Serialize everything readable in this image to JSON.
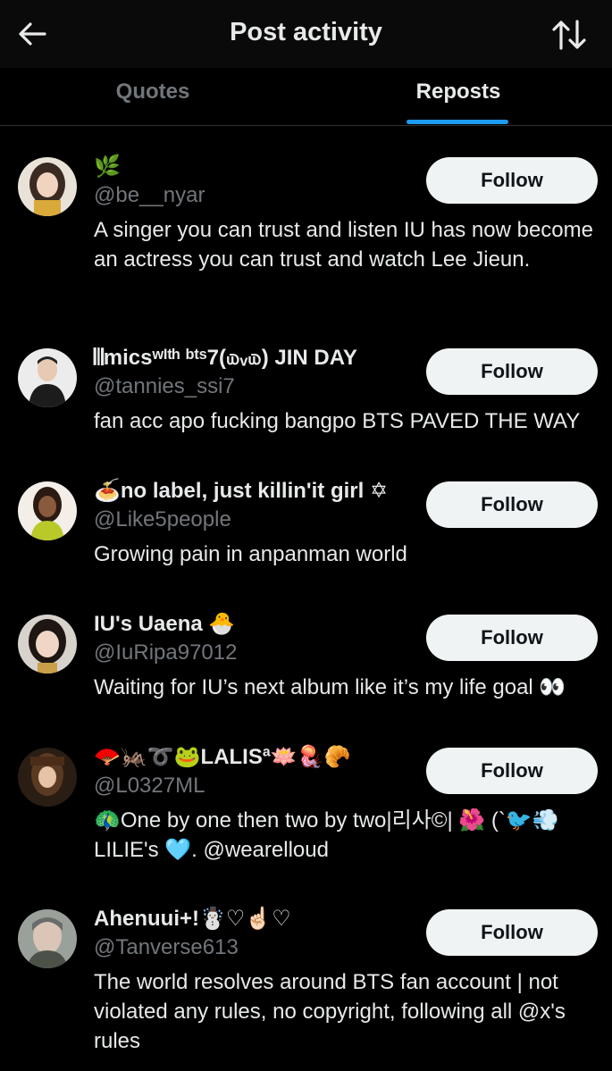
{
  "header": {
    "title": "Post activity",
    "back_icon": "arrow-left-icon",
    "sort_icon": "sort-arrows-icon"
  },
  "tabs": [
    {
      "label": "Quotes",
      "active": false
    },
    {
      "label": "Reposts",
      "active": true
    }
  ],
  "colors": {
    "background": "#000000",
    "accent": "#1d9bf0",
    "follow_button_bg": "#eff3f4",
    "text_secondary": "#71767b"
  },
  "users": [
    {
      "name": "🌿",
      "handle": "@be__nyar",
      "bio": "A singer you can trust and listen IU has now become an actress you can trust and watch Lee Jieun.",
      "follow_label": "Follow"
    },
    {
      "name": "𝄃𝄂micsʷᴵᵗʰ ᵇᵗˢ7(௰ᵥ௰) JIN DAY",
      "handle": "@tannies_ssi7",
      "bio": "fan acc apo fucking bangpo BTS PAVED THE WAY",
      "follow_label": "Follow"
    },
    {
      "name": "🍝no label, just killin'it girl ✡",
      "handle": "@Like5people",
      "bio": "Growing pain in anpanman world",
      "follow_label": "Follow"
    },
    {
      "name": "IU's Uaena 🐣",
      "handle": "@IuRipa97012",
      "bio": "Waiting for IU’s next album like it’s my life goal 👀",
      "follow_label": "Follow"
    },
    {
      "name": "🪭🦗➰🐸LALISª🪷🪼🥐",
      "handle": "@L0327ML",
      "bio": "🦚One by one then two by two|리사©| 🌺 (`🐦💨 LILIE's 🩵. @wearelloud",
      "follow_label": "Follow"
    },
    {
      "name": "Ahenuui+!☃️♡☝🏻♡",
      "handle": "@Tanverse613",
      "bio": "The world resolves around BTS fan account | not violated any rules, no copyright, following all @x's rules",
      "follow_label": "Follow"
    }
  ]
}
